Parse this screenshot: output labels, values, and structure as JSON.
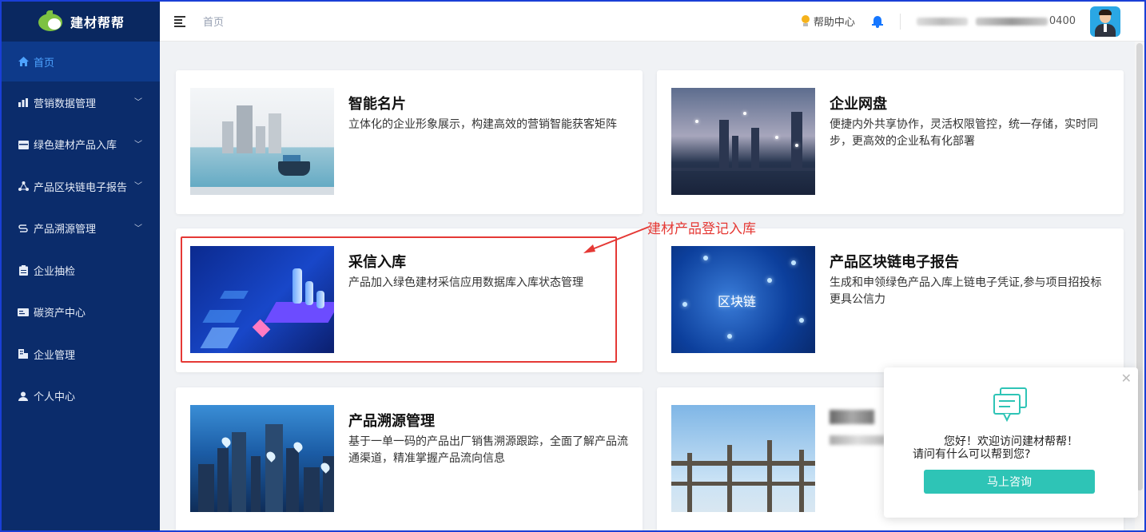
{
  "app": {
    "logo_text": "建材帮帮"
  },
  "sidebar": {
    "items": [
      {
        "label": "首页",
        "icon": "home-icon",
        "active": true,
        "expandable": false
      },
      {
        "label": "营销数据管理",
        "icon": "chart-icon",
        "expandable": true
      },
      {
        "label": "绿色建材产品入库",
        "icon": "box-icon",
        "expandable": true
      },
      {
        "label": "产品区块链电子报告",
        "icon": "network-icon",
        "expandable": true
      },
      {
        "label": "产品溯源管理",
        "icon": "trace-icon",
        "expandable": true
      },
      {
        "label": "企业抽检",
        "icon": "clipboard-icon",
        "expandable": false
      },
      {
        "label": "碳资产中心",
        "icon": "card-icon",
        "expandable": false
      },
      {
        "label": "企业管理",
        "icon": "building-icon",
        "expandable": false
      },
      {
        "label": "个人中心",
        "icon": "user-icon",
        "expandable": false
      }
    ]
  },
  "header": {
    "breadcrumb": "首页",
    "help_label": "帮助中心",
    "user_suffix": "0400"
  },
  "cards": [
    {
      "title": "智能名片",
      "desc": "立体化的企业形象展示，构建高效的营销智能获客矩阵"
    },
    {
      "title": "企业网盘",
      "desc": "便捷内外共享协作，灵活权限管控，统一存储，实时同步，更高效的企业私有化部署"
    },
    {
      "title": "采信入库",
      "desc": "产品加入绿色建材采信应用数据库入库状态管理"
    },
    {
      "title": "产品区块链电子报告",
      "desc": "生成和申领绿色产品入库上链电子凭证,参与项目招投标更具公信力",
      "thumb_label": "区块链"
    },
    {
      "title": "产品溯源管理",
      "desc": "基于一单一码的产品出厂销售溯源跟踪，全面了解产品流通渠道，精准掌握产品流向信息"
    }
  ],
  "annotation": {
    "label": "建材产品登记入库",
    "color": "#e53935"
  },
  "chat": {
    "greeting": "您好！欢迎访问建材帮帮！",
    "question": "请问有什么可以帮到您?",
    "button": "马上咨询"
  },
  "colors": {
    "sidebar_bg": "#0b2c6b",
    "accent": "#1677ff",
    "chat_button": "#2ec4b6"
  }
}
